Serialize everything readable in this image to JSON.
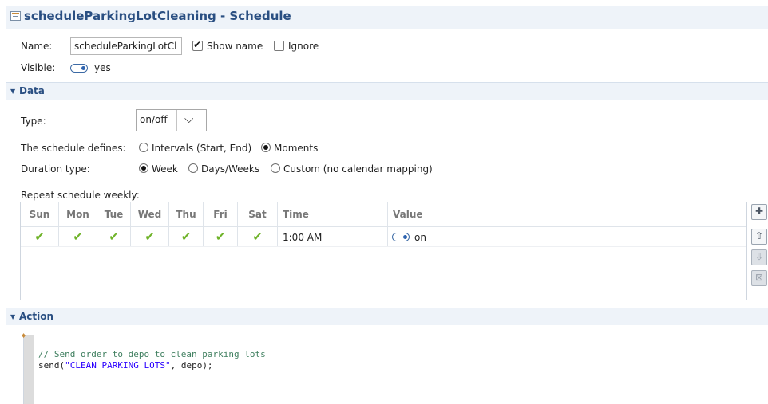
{
  "title": "scheduleParkingLotCleaning - Schedule",
  "name_label": "Name:",
  "name_value": "scheduleParkingLotCl",
  "show_name_label": "Show name",
  "ignore_label": "Ignore",
  "visible_label": "Visible:",
  "visible_value": "yes",
  "data_section": {
    "title": "Data",
    "type_label": "Type:",
    "type_value": "on/off",
    "defines_label": "The schedule defines:",
    "defines_options": [
      "Intervals (Start, End)",
      "Moments"
    ],
    "defines_selected": "Moments",
    "duration_label": "Duration type:",
    "duration_options": [
      "Week",
      "Days/Weeks",
      "Custom (no calendar mapping)"
    ],
    "duration_selected": "Week",
    "repeat_label": "Repeat schedule weekly:",
    "table": {
      "columns": [
        "Sun",
        "Mon",
        "Tue",
        "Wed",
        "Thu",
        "Fri",
        "Sat",
        "Time",
        "Value"
      ],
      "rows": [
        {
          "days": [
            true,
            true,
            true,
            true,
            true,
            true,
            true
          ],
          "time": "1:00 AM",
          "value": "on"
        }
      ]
    }
  },
  "action_section": {
    "title": "Action",
    "code_comment": "// Send order to depo to clean parking lots",
    "code_call_start": "send(",
    "code_string": "\"CLEAN PARKING LOTS\"",
    "code_call_end": ", depo);"
  }
}
